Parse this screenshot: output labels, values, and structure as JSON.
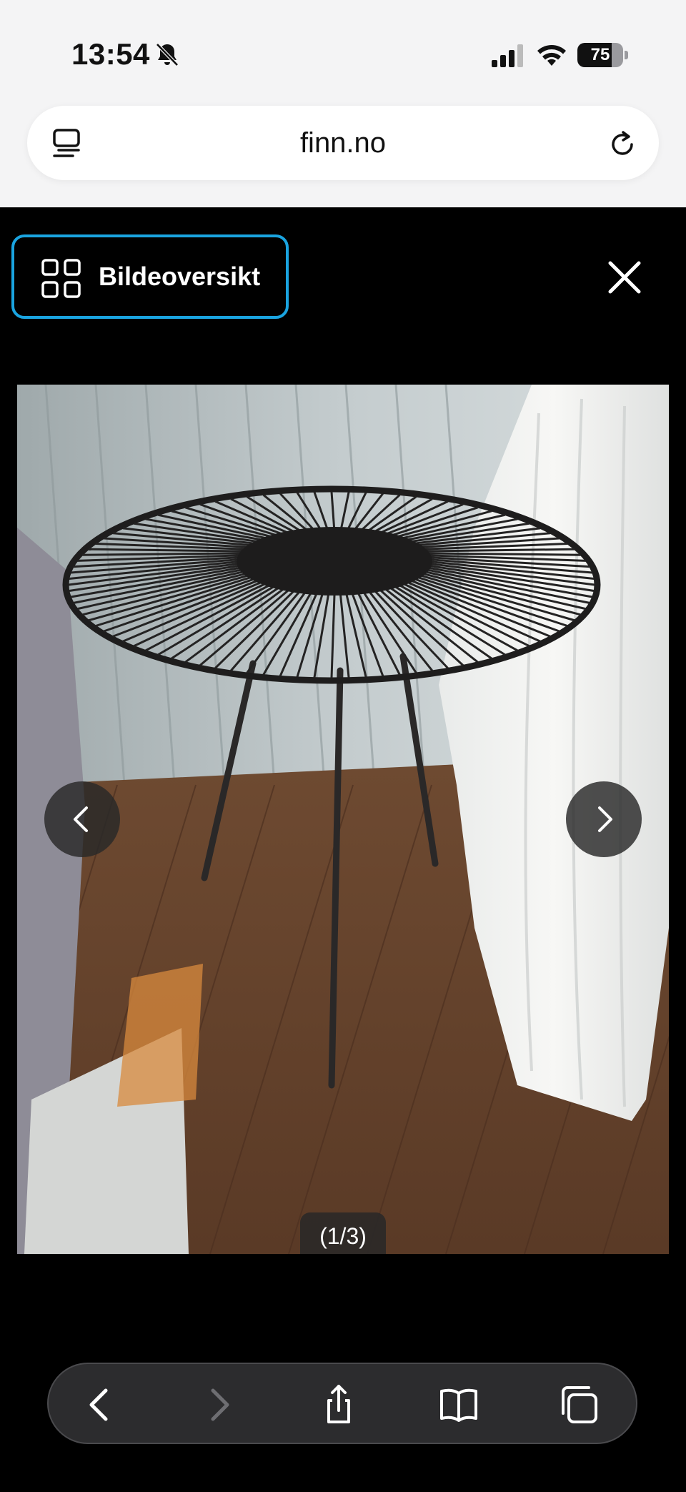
{
  "status_bar": {
    "time": "13:54",
    "battery_level": "75",
    "battery_fraction": 0.75,
    "icons": [
      "bell-slash-icon",
      "cellular-signal-icon",
      "wifi-icon",
      "battery-icon"
    ]
  },
  "browser": {
    "url": "finn.no",
    "icons": [
      "reader-mode-icon",
      "reload-icon"
    ]
  },
  "gallery": {
    "overview_label": "Bildeoversikt",
    "counter": "(1/3)",
    "icons": [
      "grid-icon",
      "close-icon",
      "chevron-left-icon",
      "chevron-right-icon"
    ]
  },
  "toolbar": {
    "icons": [
      "back-icon",
      "forward-icon",
      "share-icon",
      "bookmarks-icon",
      "tabs-icon"
    ]
  },
  "colors": {
    "accent_focus": "#1aa4e0",
    "background": "#000000",
    "toolbar": "#2c2c2e"
  }
}
